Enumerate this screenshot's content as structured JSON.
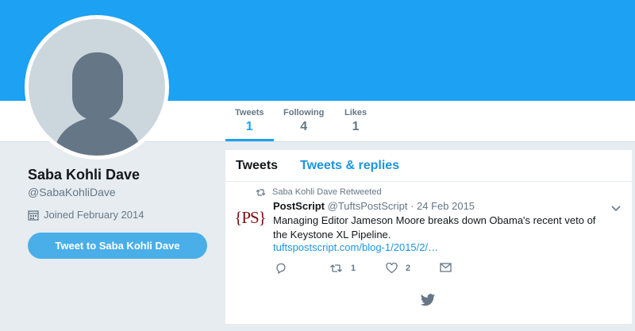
{
  "profile": {
    "name": "Saba Kohli Dave",
    "handle": "@SabaKohliDave",
    "joined": "Joined February 2014",
    "tweet_to_label": "Tweet to Saba Kohli Dave"
  },
  "nav": {
    "stats": [
      {
        "label": "Tweets",
        "value": "1"
      },
      {
        "label": "Following",
        "value": "4"
      },
      {
        "label": "Likes",
        "value": "1"
      }
    ]
  },
  "timeline": {
    "tabs": [
      "Tweets",
      "Tweets & replies"
    ],
    "retweet_notice": "Saba Kohli Dave Retweeted",
    "tweet": {
      "logo_text": "{PS}",
      "author": "PostScript",
      "meta": " @TuftsPostScript · 24 Feb 2015",
      "text": "Managing Editor Jameson Moore breaks down Obama's recent veto of the Keystone XL Pipeline.",
      "link": "tuftspostscript.com/blog-1/2015/2/…",
      "retweets": "1",
      "likes": "2"
    }
  },
  "colors": {
    "brand": "#1da1f2",
    "link": "#1b95e0",
    "muted": "#657786"
  }
}
